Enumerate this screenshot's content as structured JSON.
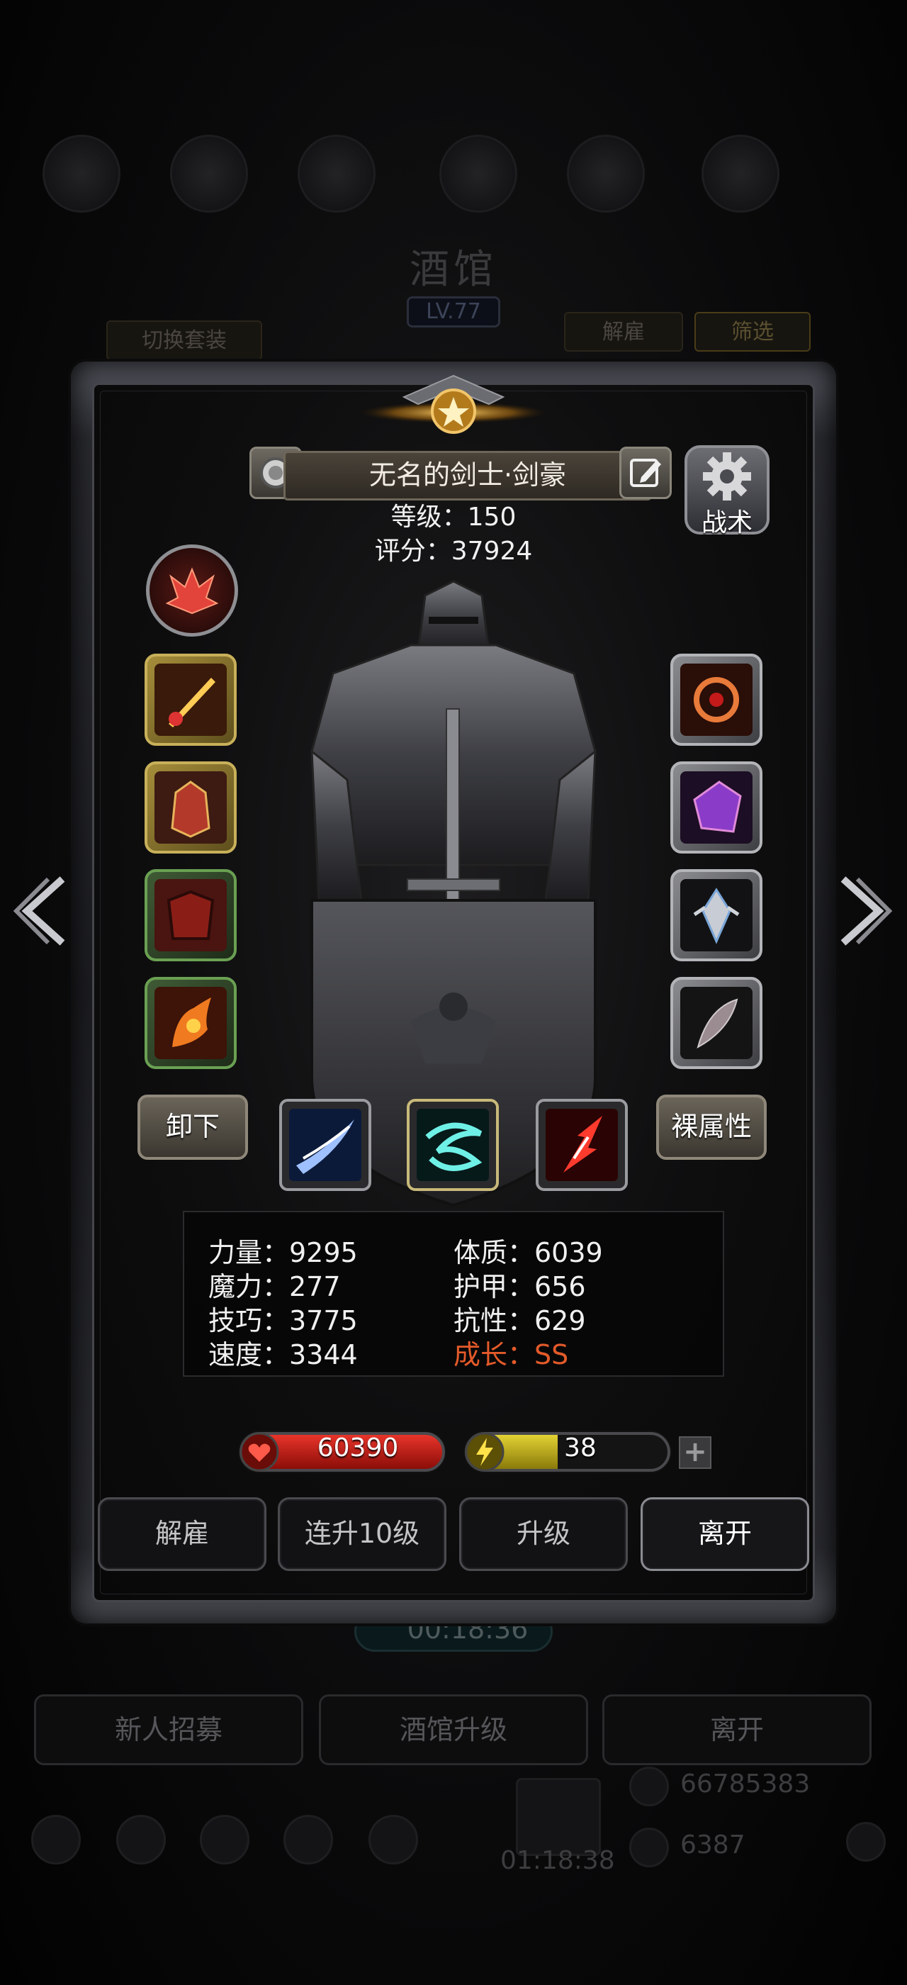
{
  "background": {
    "title": "酒馆",
    "level": "LV.77",
    "switch_outfit": "切换套装",
    "dismiss": "解雇",
    "filter": "筛选",
    "timer": "00:18:36",
    "bottom_buttons": [
      "新人招募",
      "酒馆升级",
      "离开"
    ],
    "gold": "66785383",
    "gems": "6387",
    "gift_timer": "01:18:38"
  },
  "hero": {
    "name": "无名的剑士·剑豪",
    "level_line": "等级：150",
    "score_line": "评分：37924",
    "tactics_label": "战术",
    "unequip_label": "卸下",
    "naked_attr_label": "裸属性"
  },
  "attributes": {
    "strength": "力量：9295",
    "magic": "魔力：277",
    "skill": "技巧：3775",
    "speed": "速度：3344",
    "constitution": "体质：6039",
    "armor": "护甲：656",
    "resistance": "抗性：629",
    "growth": "成长：SS"
  },
  "bars": {
    "hp": "60390",
    "energy": "38",
    "energy_fill": 0.45,
    "plus": "+"
  },
  "actions": {
    "dismiss": "解雇",
    "level_up_10": "连升10级",
    "level_up": "升级",
    "leave": "离开"
  },
  "colors": {
    "growth_text": "#e35a2a",
    "hp_bar": "#d62a20",
    "energy_bar": "#d8c72a"
  },
  "icons": {
    "left_slots": [
      "sword-weapon-icon",
      "helmet-armor-icon",
      "chest-armor-icon",
      "flame-boots-icon"
    ],
    "right_slots": [
      "demon-ring-icon",
      "purple-crystal-icon",
      "silver-emblem-icon",
      "feather-charm-icon"
    ],
    "skills": [
      "blue-slash-skill-icon",
      "cyan-whirl-skill-icon",
      "red-strike-skill-icon"
    ]
  }
}
